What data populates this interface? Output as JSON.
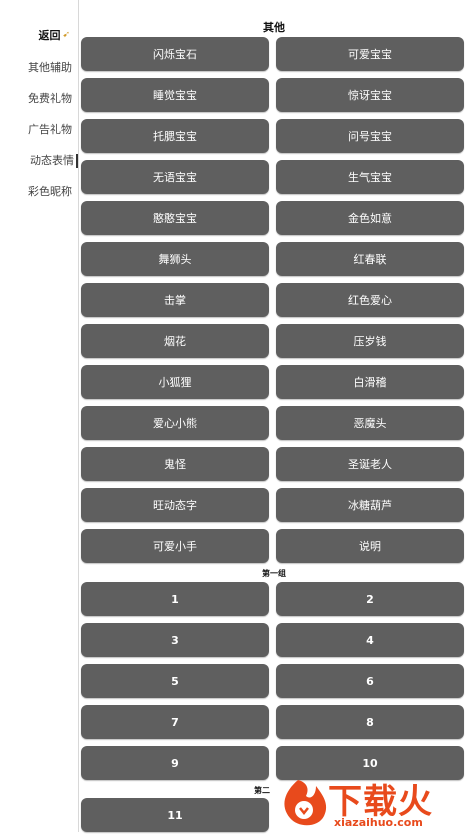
{
  "sidebar": {
    "back_label": "返回",
    "back_icon": "arrow-icon",
    "items": [
      {
        "label": "其他辅助",
        "active": false
      },
      {
        "label": "免费礼物",
        "active": false
      },
      {
        "label": "广告礼物",
        "active": false
      },
      {
        "label": "动态表情",
        "active": true
      },
      {
        "label": "彩色昵称",
        "active": false
      }
    ]
  },
  "main": {
    "section_title": "其他",
    "buttons": [
      "闪烁宝石",
      "可爱宝宝",
      "睡觉宝宝",
      "惊讶宝宝",
      "托腮宝宝",
      "问号宝宝",
      "无语宝宝",
      "生气宝宝",
      "憨憨宝宝",
      "金色如意",
      "舞狮头",
      "红春联",
      "击掌",
      "红色爱心",
      "烟花",
      "压岁钱",
      "小狐狸",
      "白滑稽",
      "爱心小熊",
      "恶魔头",
      "鬼怪",
      "圣诞老人",
      "旺动态字",
      "冰糖葫芦",
      "可爱小手",
      "说明"
    ],
    "group1_title": "第一组",
    "group1_buttons": [
      "1",
      "2",
      "3",
      "4",
      "5",
      "6",
      "7",
      "8",
      "9",
      "10"
    ],
    "group2_title": "第二",
    "group2_buttons": [
      "11"
    ]
  },
  "watermark": {
    "text": "下载火",
    "url_text": "xiazaihuo.com",
    "color": "#e84a1c"
  },
  "colors": {
    "button_bg": "#5f5f5f",
    "button_text": "#ffffff"
  }
}
